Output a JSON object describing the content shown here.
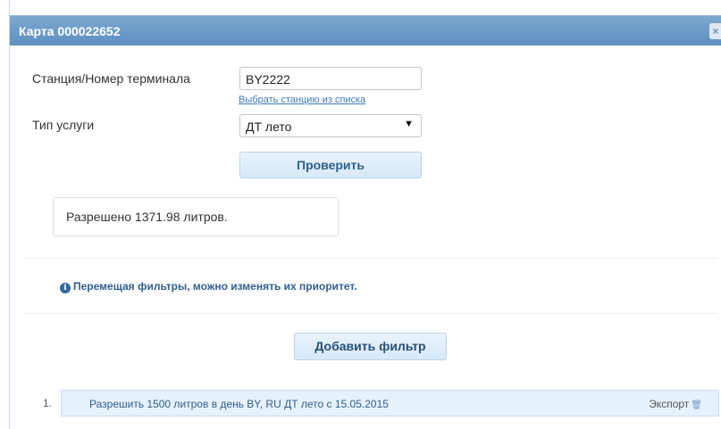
{
  "dialog": {
    "title": "Карта 000022652",
    "close_label": "×"
  },
  "form": {
    "station_label": "Станция/Номер терминала",
    "station_value": "BY2222",
    "choose_station_link": "Выбрать станцию из списка",
    "service_label": "Тип услуги",
    "service_value": "ДТ лето",
    "check_button": "Проверить"
  },
  "result": {
    "text": "Разрешено 1371.98 литров."
  },
  "info": {
    "icon": "i",
    "text": "Перемещая фильтры, можно изменять их приоритет."
  },
  "add_filter_button": "Добавить фильтр",
  "filters": [
    {
      "number": "1.",
      "text": "Разрешить 1500 литров в день BY, RU ДТ лето с 15.05.2015",
      "export_label": "Экспорт"
    }
  ]
}
